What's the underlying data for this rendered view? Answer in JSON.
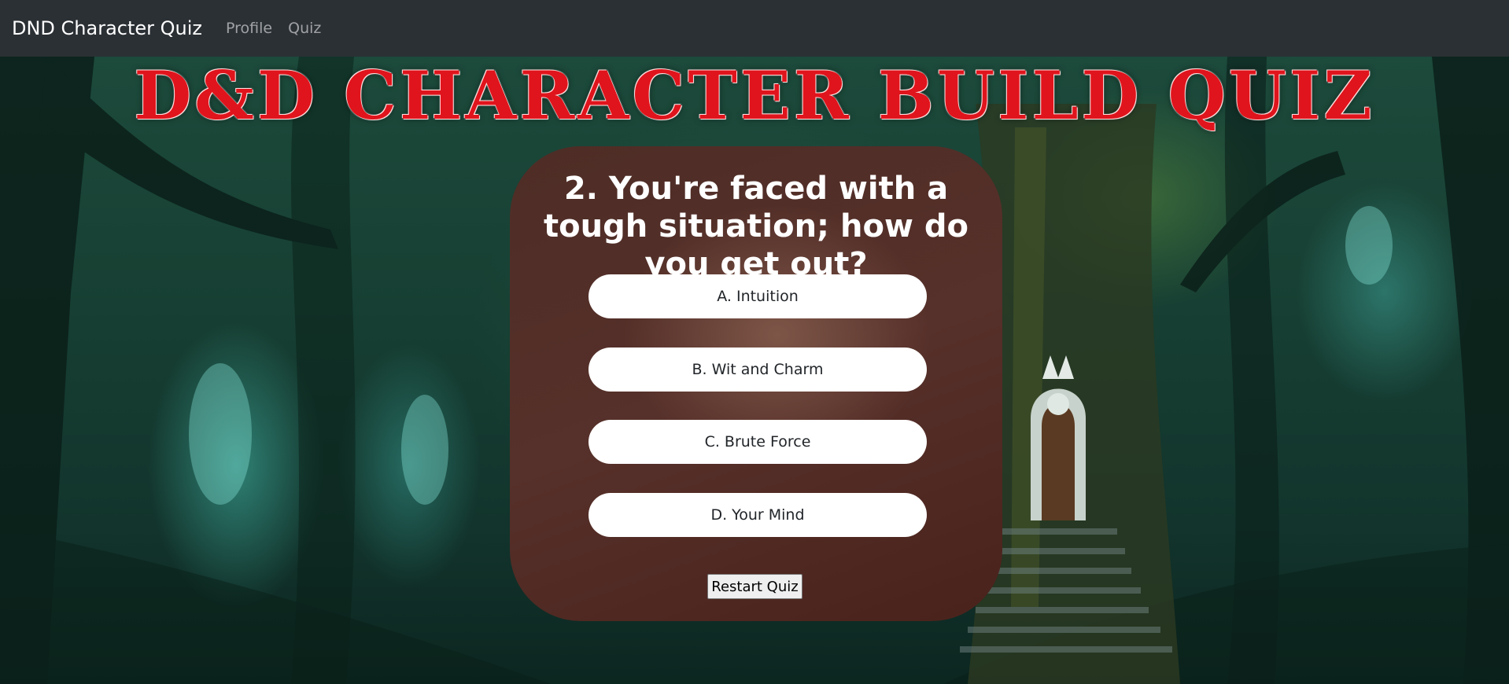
{
  "navbar": {
    "brand": "DND Character Quiz",
    "links": [
      "Profile",
      "Quiz"
    ]
  },
  "page": {
    "title": "D&D Character Build Quiz"
  },
  "quiz": {
    "question": "2. You're faced with a tough situation; how do you get out?",
    "answers": [
      "A. Intuition",
      "B. Wit and Charm",
      "C. Brute Force",
      "D. Your Mind"
    ],
    "restart_label": "Restart Quiz"
  },
  "colors": {
    "navbar_bg": "#2b3035",
    "title_red": "#e0141c",
    "card_bg": "#4e2d26",
    "answer_bg": "#ffffff"
  }
}
